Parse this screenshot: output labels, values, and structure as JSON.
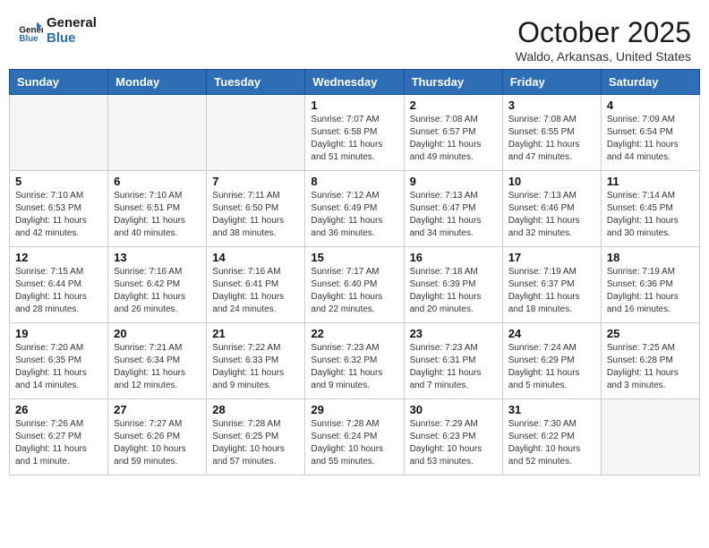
{
  "header": {
    "logo_general": "General",
    "logo_blue": "Blue",
    "month_title": "October 2025",
    "location": "Waldo, Arkansas, United States"
  },
  "days_of_week": [
    "Sunday",
    "Monday",
    "Tuesday",
    "Wednesday",
    "Thursday",
    "Friday",
    "Saturday"
  ],
  "weeks": [
    [
      {
        "day": "",
        "info": ""
      },
      {
        "day": "",
        "info": ""
      },
      {
        "day": "",
        "info": ""
      },
      {
        "day": "1",
        "info": "Sunrise: 7:07 AM\nSunset: 6:58 PM\nDaylight: 11 hours and 51 minutes."
      },
      {
        "day": "2",
        "info": "Sunrise: 7:08 AM\nSunset: 6:57 PM\nDaylight: 11 hours and 49 minutes."
      },
      {
        "day": "3",
        "info": "Sunrise: 7:08 AM\nSunset: 6:55 PM\nDaylight: 11 hours and 47 minutes."
      },
      {
        "day": "4",
        "info": "Sunrise: 7:09 AM\nSunset: 6:54 PM\nDaylight: 11 hours and 44 minutes."
      }
    ],
    [
      {
        "day": "5",
        "info": "Sunrise: 7:10 AM\nSunset: 6:53 PM\nDaylight: 11 hours and 42 minutes."
      },
      {
        "day": "6",
        "info": "Sunrise: 7:10 AM\nSunset: 6:51 PM\nDaylight: 11 hours and 40 minutes."
      },
      {
        "day": "7",
        "info": "Sunrise: 7:11 AM\nSunset: 6:50 PM\nDaylight: 11 hours and 38 minutes."
      },
      {
        "day": "8",
        "info": "Sunrise: 7:12 AM\nSunset: 6:49 PM\nDaylight: 11 hours and 36 minutes."
      },
      {
        "day": "9",
        "info": "Sunrise: 7:13 AM\nSunset: 6:47 PM\nDaylight: 11 hours and 34 minutes."
      },
      {
        "day": "10",
        "info": "Sunrise: 7:13 AM\nSunset: 6:46 PM\nDaylight: 11 hours and 32 minutes."
      },
      {
        "day": "11",
        "info": "Sunrise: 7:14 AM\nSunset: 6:45 PM\nDaylight: 11 hours and 30 minutes."
      }
    ],
    [
      {
        "day": "12",
        "info": "Sunrise: 7:15 AM\nSunset: 6:44 PM\nDaylight: 11 hours and 28 minutes."
      },
      {
        "day": "13",
        "info": "Sunrise: 7:16 AM\nSunset: 6:42 PM\nDaylight: 11 hours and 26 minutes."
      },
      {
        "day": "14",
        "info": "Sunrise: 7:16 AM\nSunset: 6:41 PM\nDaylight: 11 hours and 24 minutes."
      },
      {
        "day": "15",
        "info": "Sunrise: 7:17 AM\nSunset: 6:40 PM\nDaylight: 11 hours and 22 minutes."
      },
      {
        "day": "16",
        "info": "Sunrise: 7:18 AM\nSunset: 6:39 PM\nDaylight: 11 hours and 20 minutes."
      },
      {
        "day": "17",
        "info": "Sunrise: 7:19 AM\nSunset: 6:37 PM\nDaylight: 11 hours and 18 minutes."
      },
      {
        "day": "18",
        "info": "Sunrise: 7:19 AM\nSunset: 6:36 PM\nDaylight: 11 hours and 16 minutes."
      }
    ],
    [
      {
        "day": "19",
        "info": "Sunrise: 7:20 AM\nSunset: 6:35 PM\nDaylight: 11 hours and 14 minutes."
      },
      {
        "day": "20",
        "info": "Sunrise: 7:21 AM\nSunset: 6:34 PM\nDaylight: 11 hours and 12 minutes."
      },
      {
        "day": "21",
        "info": "Sunrise: 7:22 AM\nSunset: 6:33 PM\nDaylight: 11 hours and 9 minutes."
      },
      {
        "day": "22",
        "info": "Sunrise: 7:23 AM\nSunset: 6:32 PM\nDaylight: 11 hours and 9 minutes."
      },
      {
        "day": "23",
        "info": "Sunrise: 7:23 AM\nSunset: 6:31 PM\nDaylight: 11 hours and 7 minutes."
      },
      {
        "day": "24",
        "info": "Sunrise: 7:24 AM\nSunset: 6:29 PM\nDaylight: 11 hours and 5 minutes."
      },
      {
        "day": "25",
        "info": "Sunrise: 7:25 AM\nSunset: 6:28 PM\nDaylight: 11 hours and 3 minutes."
      }
    ],
    [
      {
        "day": "26",
        "info": "Sunrise: 7:26 AM\nSunset: 6:27 PM\nDaylight: 11 hours and 1 minute."
      },
      {
        "day": "27",
        "info": "Sunrise: 7:27 AM\nSunset: 6:26 PM\nDaylight: 10 hours and 59 minutes."
      },
      {
        "day": "28",
        "info": "Sunrise: 7:28 AM\nSunset: 6:25 PM\nDaylight: 10 hours and 57 minutes."
      },
      {
        "day": "29",
        "info": "Sunrise: 7:28 AM\nSunset: 6:24 PM\nDaylight: 10 hours and 55 minutes."
      },
      {
        "day": "30",
        "info": "Sunrise: 7:29 AM\nSunset: 6:23 PM\nDaylight: 10 hours and 53 minutes."
      },
      {
        "day": "31",
        "info": "Sunrise: 7:30 AM\nSunset: 6:22 PM\nDaylight: 10 hours and 52 minutes."
      },
      {
        "day": "",
        "info": ""
      }
    ]
  ]
}
